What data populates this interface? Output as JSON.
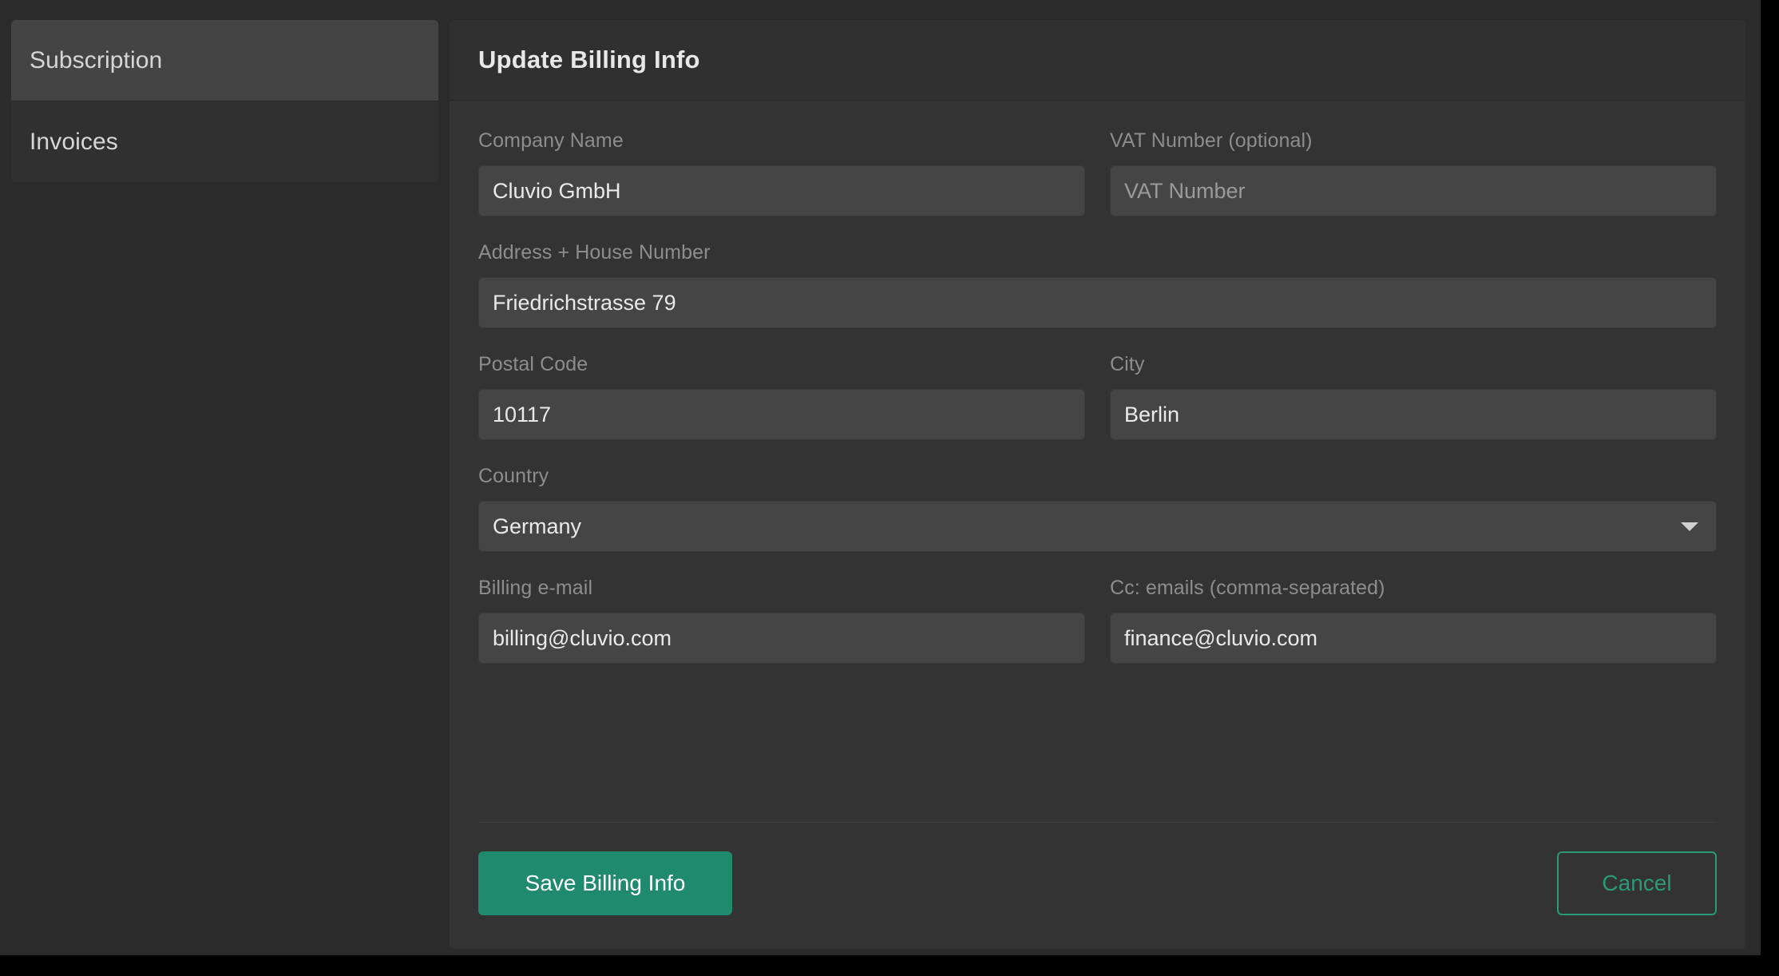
{
  "theme": {
    "page_background": "#000000",
    "app_background": "#2b2b2b",
    "card_background": "#333333",
    "card_header_background": "#303030",
    "input_background": "#454545",
    "accent_green": "#1f8a6d",
    "accent_green_outline": "#2a9a78",
    "label_color": "#8d8d8d",
    "text_color": "#eaeaea"
  },
  "sidebar": {
    "items": [
      {
        "label": "Subscription",
        "active": true
      },
      {
        "label": "Invoices",
        "active": false
      }
    ]
  },
  "card": {
    "title": "Update Billing Info",
    "fields": {
      "company_name": {
        "label": "Company Name",
        "value": "Cluvio GmbH",
        "placeholder": "Company Name"
      },
      "vat_number": {
        "label": "VAT Number (optional)",
        "value": "",
        "placeholder": "VAT Number"
      },
      "address": {
        "label": "Address + House Number",
        "value": "Friedrichstrasse 79",
        "placeholder": "Address + House Number"
      },
      "postal_code": {
        "label": "Postal Code",
        "value": "10117",
        "placeholder": "Postal Code"
      },
      "city": {
        "label": "City",
        "value": "Berlin",
        "placeholder": "City"
      },
      "country": {
        "label": "Country",
        "value": "Germany",
        "icon": "chevron-down-icon"
      },
      "billing_email": {
        "label": "Billing e-mail",
        "value": "billing@cluvio.com",
        "placeholder": "Billing e-mail"
      },
      "cc_emails": {
        "label": "Cc: emails (comma-separated)",
        "value": "finance@cluvio.com",
        "placeholder": "Cc: emails (comma-separated)"
      }
    },
    "footer": {
      "save_label": "Save Billing Info",
      "cancel_label": "Cancel"
    }
  }
}
